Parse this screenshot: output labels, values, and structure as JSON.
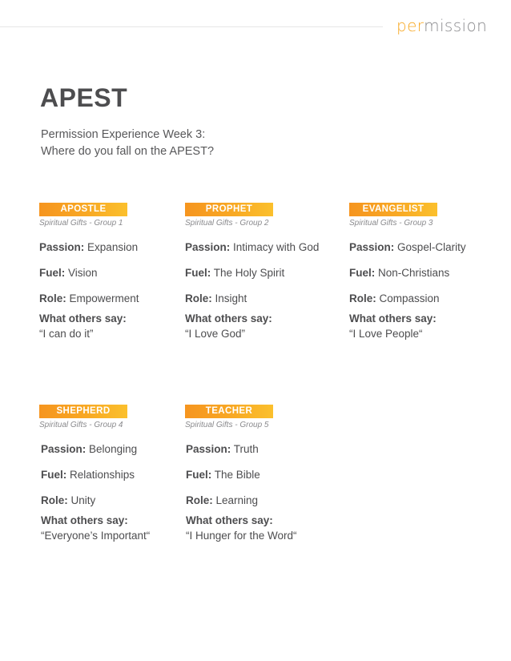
{
  "header": {
    "brand_accent": "per",
    "brand_rest": "mission",
    "accent_color": "#f7a823"
  },
  "page": {
    "title": "APEST",
    "subtitle_line1": "Permission Experience Week 3:",
    "subtitle_line2": "Where do you fall on the APEST?"
  },
  "labels": {
    "passion": "Passion:",
    "fuel": "Fuel:",
    "role": "Role:",
    "others": "What others say:"
  },
  "cards": [
    {
      "name": "APOSTLE",
      "group": "Spiritual Gifts - Group 1",
      "passion": "Expansion",
      "fuel": "Vision",
      "role": "Empowerment",
      "quote": "“I can do it”"
    },
    {
      "name": "PROPHET",
      "group": "Spiritual Gifts - Group 2",
      "passion": "Intimacy with God",
      "fuel": "The Holy Spirit",
      "role": "Insight",
      "quote": "“I Love God”"
    },
    {
      "name": "EVANGELIST",
      "group": "Spiritual Gifts - Group 3",
      "passion": "Gospel-Clarity",
      "fuel": "Non-Christians",
      "role": "Compassion",
      "quote": "“I Love People“"
    },
    {
      "name": "SHEPHERD",
      "group": "Spiritual Gifts - Group 4",
      "passion": "Belonging",
      "fuel": "Relationships",
      "role": "Unity",
      "quote": "“Everyone’s Important“"
    },
    {
      "name": "TEACHER",
      "group": "Spiritual Gifts - Group 5",
      "passion": "Truth",
      "fuel": "The Bible",
      "role": "Learning",
      "quote": "“I Hunger for the Word“"
    }
  ]
}
